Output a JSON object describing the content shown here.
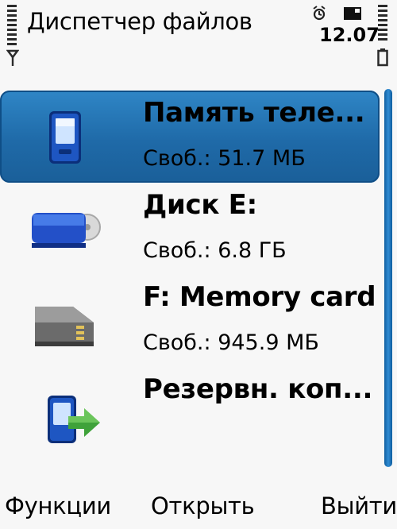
{
  "status_bar": {
    "app_title": "Диспетчер файлов",
    "time": "12.07",
    "icons": [
      "signal-strength-icon",
      "antenna-icon",
      "alarm-icon",
      "message-icon",
      "battery-icon"
    ]
  },
  "file_manager": {
    "items": [
      {
        "title": "Память теле...",
        "subtitle": "Своб.: 51.7 МБ",
        "icon": "phone-memory-icon",
        "selected": true
      },
      {
        "title": "Диск E:",
        "subtitle": "Своб.: 6.8 ГБ",
        "icon": "mass-memory-drive-icon",
        "selected": false
      },
      {
        "title": "F: Memory card",
        "subtitle": "Своб.: 945.9 МБ",
        "icon": "memory-card-icon",
        "selected": false
      },
      {
        "title": "Резервн. коп...",
        "subtitle": "",
        "icon": "backup-icon",
        "selected": false
      }
    ]
  },
  "softkeys": {
    "left": "Функции",
    "middle": "Открыть",
    "right": "Выйти"
  },
  "colors": {
    "background": "#f7f7f7",
    "selection": "#1f6aa8",
    "scrollbar": "#1a6db5"
  }
}
